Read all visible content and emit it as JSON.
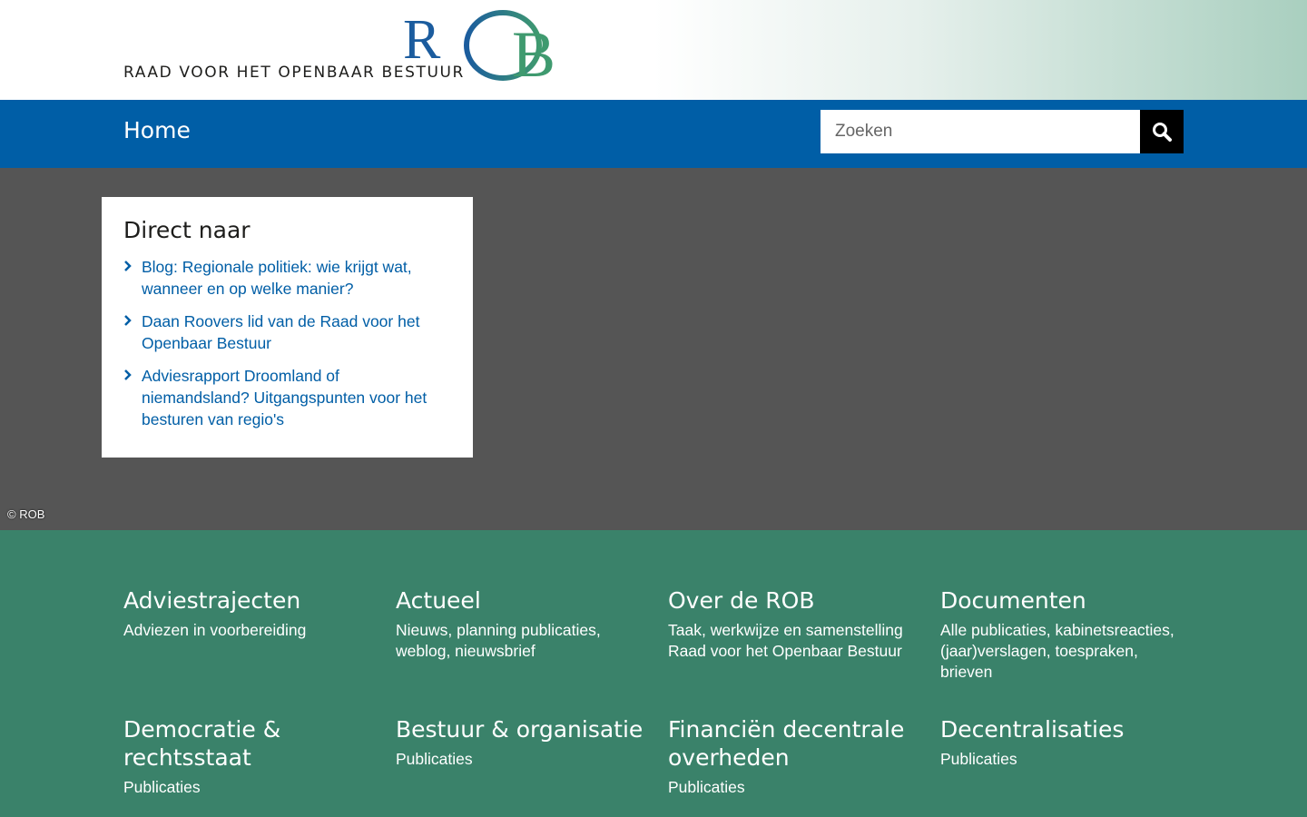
{
  "header": {
    "logo_text": "ROB",
    "logo_tagline": "RAAD VOOR HET OPENBAAR BESTUUR",
    "brand_colors": {
      "blue": "#005ea6",
      "green": "#3a826a",
      "dark": "#555555"
    }
  },
  "nav": {
    "home_label": "Home",
    "search_placeholder": "Zoeken",
    "search_icon": "search-icon"
  },
  "hero": {
    "direct_title": "Direct naar",
    "links": [
      {
        "label": "Blog: Regionale politiek: wie krijgt wat, wanneer en op welke manier?"
      },
      {
        "label": "Daan Roovers lid van de Raad voor het Openbaar Bestuur"
      },
      {
        "label": "Adviesrapport Droomland of niemandsland? Uitgangspunten voor het besturen van regio's"
      }
    ],
    "copyright": "© ROB"
  },
  "footer": {
    "columns": [
      {
        "title": "Adviestrajecten",
        "subtitle": "Adviezen in voorbereiding"
      },
      {
        "title": "Actueel",
        "subtitle": "Nieuws, planning publicaties, weblog, nieuwsbrief"
      },
      {
        "title": "Over de ROB",
        "subtitle": "Taak, werkwijze en samenstelling Raad voor het Openbaar Bestuur"
      },
      {
        "title": "Documenten",
        "subtitle": "Alle publicaties, kabinetsreacties, (jaar)verslagen, toespraken, brieven"
      },
      {
        "title": "Democratie & rechtsstaat",
        "subtitle": "Publicaties"
      },
      {
        "title": "Bestuur & organisatie",
        "subtitle": "Publicaties"
      },
      {
        "title": "Financiën decentrale overheden",
        "subtitle": "Publicaties"
      },
      {
        "title": "Decentralisaties",
        "subtitle": "Publicaties"
      }
    ]
  }
}
